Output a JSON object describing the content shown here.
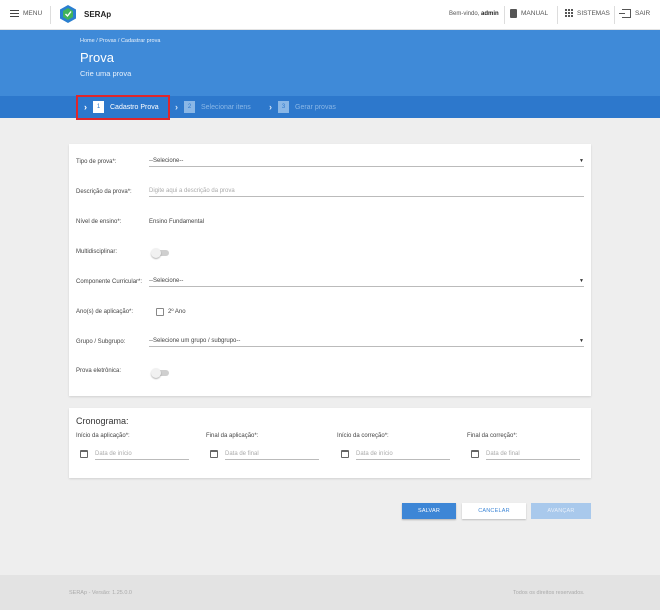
{
  "topbar": {
    "menu_label": "MENU",
    "brand": "SERAp",
    "welcome_prefix": "Bem-vindo,",
    "welcome_user": "admin",
    "manual_label": "MANUAL",
    "systems_label": "SISTEMAS",
    "exit_label": "SAIR"
  },
  "header": {
    "breadcrumb": "Home / Provas / Cadastrar prova",
    "title": "Prova",
    "subtitle": "Crie uma prova"
  },
  "stepper": {
    "steps": [
      {
        "number": "1",
        "label": "Cadastro Prova",
        "state": "active"
      },
      {
        "number": "2",
        "label": "Selecionar itens",
        "state": "inactive"
      },
      {
        "number": "3",
        "label": "Gerar provas",
        "state": "inactive"
      }
    ]
  },
  "form": {
    "tipo_prova_label": "Tipo de prova*:",
    "tipo_prova_value": "--Selecione--",
    "descricao_label": "Descrição da prova*:",
    "descricao_placeholder": "Digite aqui a descrição da prova",
    "nivel_label": "Nível de ensino*:",
    "nivel_value": "Ensino Fundamental",
    "multidisciplinar_label": "Multidisciplinar:",
    "componente_label": "Componente Curricular*:",
    "componente_value": "--Selecione--",
    "anos_label": "Ano(s) de aplicação*:",
    "ano_option": "2º Ano",
    "grupo_label": "Grupo / Subgrupo:",
    "grupo_value": "--Selecione um grupo / subgrupo--",
    "eletronica_label": "Prova eletrônica:"
  },
  "schedule": {
    "title": "Cronograma:",
    "fields": [
      {
        "label": "Início da aplicação*:",
        "placeholder": "Data de início"
      },
      {
        "label": "Final da aplicação*:",
        "placeholder": "Data de final"
      },
      {
        "label": "Início da correção*:",
        "placeholder": "Data de início"
      },
      {
        "label": "Final da correção*:",
        "placeholder": "Data de final"
      }
    ]
  },
  "actions": {
    "save": "SALVAR",
    "cancel": "CANCELAR",
    "next": "AVANÇAR"
  },
  "footer": {
    "version": "SERAp - Versão: 1.25.0.0",
    "rights": "Todos os direitos reservados."
  },
  "colors": {
    "primary": "#3f8ad8",
    "stepper": "#2d78cc",
    "highlight": "#e0262b"
  }
}
